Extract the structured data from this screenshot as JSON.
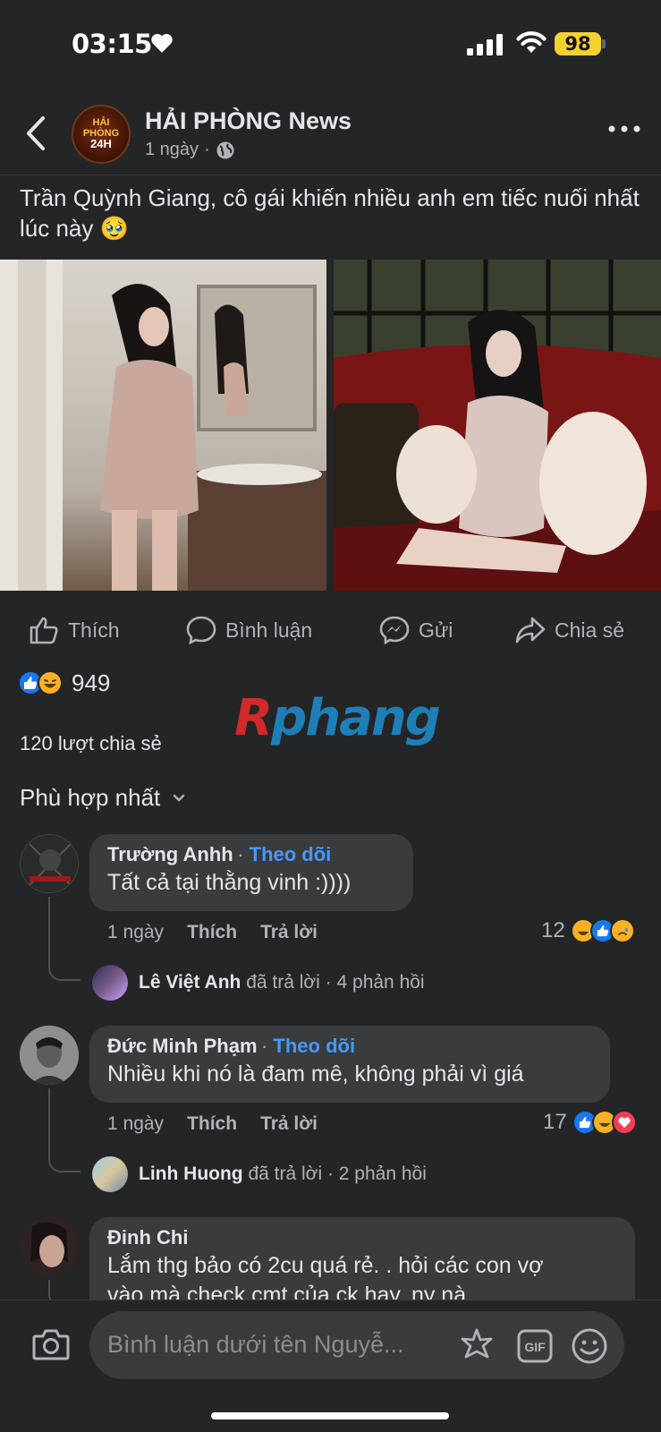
{
  "status_bar": {
    "time": "03:15",
    "battery": "98"
  },
  "post": {
    "page_name": "HẢI PHÒNG News",
    "age": "1 ngày",
    "text": "Trần Quỳnh Giang, cô gái khiến nhiều anh em tiếc nuối nhất lúc này 🥹",
    "avatar_logo": {
      "top": "HẢI",
      "middle": "PHÒNG",
      "bottom": "24H"
    }
  },
  "actions": {
    "like": "Thích",
    "comment": "Bình luận",
    "send": "Gửi",
    "share": "Chia sẻ"
  },
  "stats": {
    "reactions": "949",
    "shares": "120 lượt chia sẻ"
  },
  "watermark": {
    "part1": "R",
    "part2": "phang"
  },
  "sort_label": "Phù hợp nhất",
  "comments": [
    {
      "author": "Trường Anhh",
      "follow": "Theo dõi",
      "text": "Tất cả tại thằng vinh :))))",
      "age": "1 ngày",
      "like": "Thích",
      "reply": "Trả lời",
      "reaction_count": "12",
      "reply_author": "Lê Việt Anh",
      "reply_text": "đã trả lời · 4 phản hồi"
    },
    {
      "author": "Đức Minh Phạm",
      "follow": "Theo dõi",
      "text": "Nhiều khi nó là đam mê, không phải vì giá",
      "age": "1 ngày",
      "like": "Thích",
      "reply": "Trả lời",
      "reaction_count": "17",
      "reply_author": "Linh Huong",
      "reply_text": "đã trả lời · 2 phản hồi"
    },
    {
      "author": "Đinh Chi",
      "text": "Lắm thg bảo có 2cu quá rẻ. . hỏi các con vợ",
      "text_line2": "vào mà check cmt của ck hay. ny nà"
    }
  ],
  "composer": {
    "placeholder": "Bình luận dưới tên Nguyễ..."
  },
  "colors": {
    "background": "#242526",
    "bubble": "#3a3b3c",
    "accent": "#4599ff",
    "like_blue": "#1877f2"
  }
}
